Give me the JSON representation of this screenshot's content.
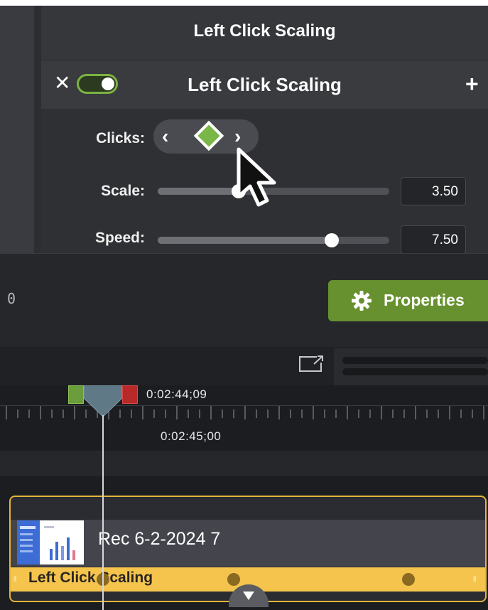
{
  "panel": {
    "title": "Left Click Scaling",
    "effect_name": "Left Click Scaling",
    "enabled": true,
    "close_glyph": "✕",
    "add_glyph": "+"
  },
  "controls": {
    "clicks_label": "Clicks:",
    "prev_glyph": "‹",
    "next_glyph": "›",
    "scale_label": "Scale:",
    "scale_value": "3.50",
    "scale_level": 0.35,
    "speed_label": "Speed:",
    "speed_value": "7.50",
    "speed_level": 0.75
  },
  "properties": {
    "button_label": "Properties",
    "left_partial": "0"
  },
  "timeline": {
    "time_marker": "0:02:44;09",
    "ruler_time": "0:02:45;00"
  },
  "clip": {
    "name": "Rec 6-2-2024 7",
    "effect_label": "Left Click Scaling",
    "grip_glyph": "⦀"
  },
  "colors": {
    "accent_green": "#67912f",
    "toggle_green": "#7cb342",
    "clip_border": "#e3b53a",
    "effect_strip": "#f4c44d",
    "marker_red": "#b8292a"
  },
  "icons": {
    "properties": "gear-icon",
    "keyframe": "diamond-icon",
    "export": "export-icon",
    "cursor": "mouse-pointer-icon"
  }
}
